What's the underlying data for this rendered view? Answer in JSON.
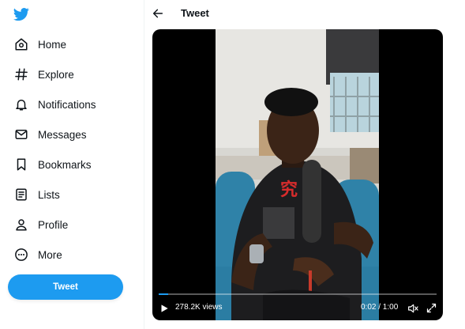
{
  "sidebar": {
    "logo_icon": "twitter-bird-icon",
    "items": [
      {
        "label": "Home",
        "icon": "home-icon"
      },
      {
        "label": "Explore",
        "icon": "hashtag-icon"
      },
      {
        "label": "Notifications",
        "icon": "bell-icon"
      },
      {
        "label": "Messages",
        "icon": "envelope-icon"
      },
      {
        "label": "Bookmarks",
        "icon": "bookmark-icon"
      },
      {
        "label": "Lists",
        "icon": "list-icon"
      },
      {
        "label": "Profile",
        "icon": "person-icon"
      },
      {
        "label": "More",
        "icon": "more-circle-icon"
      }
    ],
    "tweet_button": "Tweet"
  },
  "header": {
    "back_icon": "back-arrow-icon",
    "title": "Tweet"
  },
  "video": {
    "views": "278.2K views",
    "time": "0:02 / 1:00",
    "progress": 0.033
  },
  "colors": {
    "accent": "#1d9bf0",
    "text": "#0f1419",
    "divider": "#eff3f4"
  }
}
